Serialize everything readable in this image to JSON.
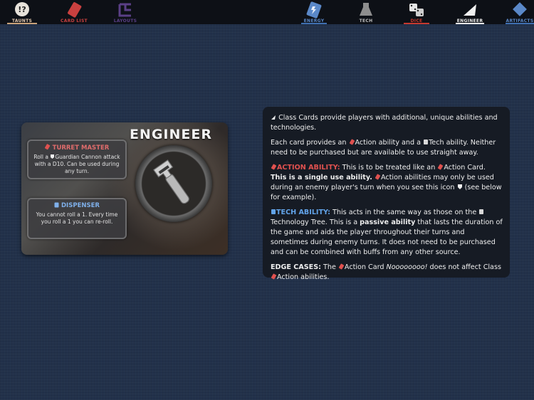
{
  "nav": {
    "tabs": [
      {
        "label": "TAUNTS",
        "icon": "taunts-icon",
        "color": "#e3c9b0",
        "bar": "#c9a27a"
      },
      {
        "label": "CARD LIST",
        "icon": "card-list-icon",
        "color": "#c9403f",
        "bar": "#c9403f"
      },
      {
        "label": "LAYOUTS",
        "icon": "layouts-icon",
        "color": "#5a3f86",
        "bar": "#5a3f86"
      },
      {
        "label": "ENERGY",
        "icon": "energy-icon",
        "color": "#5a88c8",
        "bar": "#3f6fb0"
      },
      {
        "label": "TECH",
        "icon": "tech-icon",
        "color": "#bcbcbc",
        "bar": "#9a9a9a"
      },
      {
        "label": "DICE",
        "icon": "dice-icon",
        "color": "#c7392f",
        "bar": "#c7392f"
      },
      {
        "label": "ENGINEER",
        "icon": "engineer-icon",
        "color": "#f0f0f0",
        "bar": "#e9e9e9"
      },
      {
        "label": "ARTIFACTS",
        "icon": "artifacts-icon",
        "color": "#5a88c8",
        "bar": "#3f6fb0"
      }
    ]
  },
  "card": {
    "title": "ENGINEER",
    "action": {
      "name": "TURRET MASTER",
      "desc_1": "Roll a ",
      "desc_2": "Guardian Cannon attack with a D10. Can be used during any turn."
    },
    "tech": {
      "name": "DISPENSER",
      "desc": "You cannot roll a 1. Every time you roll a 1 you can re-roll."
    },
    "icon": "wrench-icon"
  },
  "panel": {
    "p1": "Class Cards provide players with additional, unique abilities and technologies.",
    "p2_a": "Each card provides an ",
    "p2_b": "Action ability and a ",
    "p2_c": "Tech ability. Neither need to be purchased but are available to use straight away.",
    "p3_label": "ACTION ABILITY:",
    "p3_a": " This is to be treated like an ",
    "p3_b": "Action Card. ",
    "p3_bold": "This is a single use ability.",
    "p3_c": " ",
    "p3_d": "Action abilities may only be used during an enemy player's turn when you see this icon ",
    "p3_e": " (see below for example).",
    "p4_label": "TECH ABILITY:",
    "p4_a": " This acts in the same way as those on the ",
    "p4_b": "Technology Tree. This is a ",
    "p4_bold": "passive ability",
    "p4_c": " that lasts the duration of the game and aids the player throughout their turns and sometimes during enemy turns. It does not need to be purchased and can be combined with buffs from any other source.",
    "p5_label": "EDGE CASES:",
    "p5_a": " The ",
    "p5_b": "Action Card ",
    "p5_italic": "Noooooooo!",
    "p5_c": " does not affect Class ",
    "p5_d": "Action abilities."
  },
  "colors": {
    "action": "#e0514f",
    "tech": "#62a4ea",
    "background": "#22314a",
    "panel": "#161b24"
  }
}
